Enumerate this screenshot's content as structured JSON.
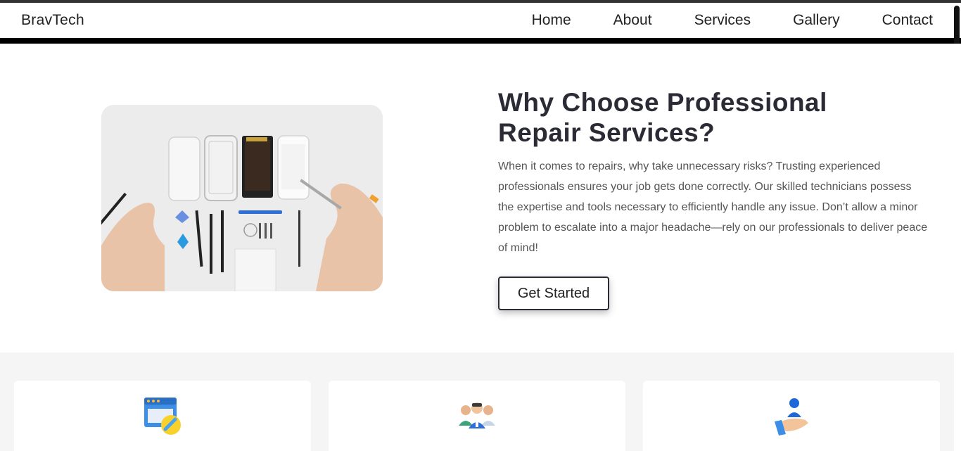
{
  "brand": "BravTech",
  "nav": {
    "items": [
      "Home",
      "About",
      "Services",
      "Gallery",
      "Contact"
    ]
  },
  "hero": {
    "title_line1": "Why Choose Professional",
    "title_line2": "Repair Services?",
    "description": "When it comes to repairs, why take unnecessary risks? Trusting experienced professionals ensures your job gets done correctly. Our skilled technicians possess the expertise and tools necessary to efficiently handle any issue. Don’t allow a minor problem to escalate into a major headache—rely on our professionals to deliver peace of mind!",
    "cta_label": "Get Started"
  },
  "features": {
    "cards": [
      {
        "icon": "web-repair-icon"
      },
      {
        "icon": "team-icon"
      },
      {
        "icon": "customer-care-icon"
      }
    ]
  }
}
